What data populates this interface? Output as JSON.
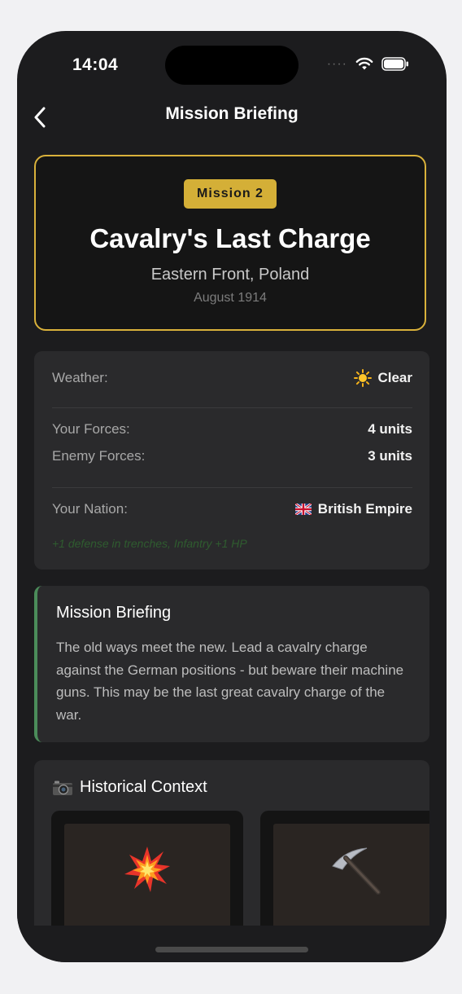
{
  "status": {
    "time": "14:04"
  },
  "nav": {
    "title": "Mission Briefing"
  },
  "mission": {
    "badge": "Mission 2",
    "title": "Cavalry's Last Charge",
    "location": "Eastern Front, Poland",
    "date": "August 1914"
  },
  "info": {
    "weather_label": "Weather:",
    "weather_value": "Clear",
    "weather_icon": "sun-icon",
    "your_forces_label": "Your Forces:",
    "your_forces_value": "4 units",
    "enemy_forces_label": "Enemy Forces:",
    "enemy_forces_value": "3 units",
    "nation_label": "Your Nation:",
    "nation_value": "British Empire",
    "nation_icon": "uk-flag-icon",
    "nation_bonus": "+1 defense in trenches, Infantry +1 HP"
  },
  "briefing": {
    "title": "Mission Briefing",
    "text": "The old ways meet the new. Lead a cavalry charge against the German positions - but beware their machine guns. This may be the last great cavalry charge of the war."
  },
  "history": {
    "title": "Historical Context",
    "icon": "camera-icon",
    "tiles": [
      {
        "icon": "explosion-icon"
      },
      {
        "icon": "pickaxe-icon"
      }
    ]
  },
  "colors": {
    "accent_gold": "#d4af37",
    "briefing_accent": "#4b8c5a",
    "background": "#1c1c1e",
    "card": "#2a2a2c"
  }
}
